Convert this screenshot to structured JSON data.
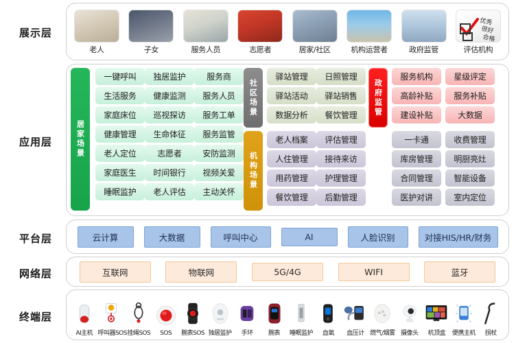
{
  "layers": [
    {
      "key": "presentation",
      "label": "展示层"
    },
    {
      "key": "application",
      "label": "应用层"
    },
    {
      "key": "platform",
      "label": "平台层"
    },
    {
      "key": "network",
      "label": "网络层"
    },
    {
      "key": "terminal",
      "label": "终端层"
    }
  ],
  "presentation": {
    "personas": [
      {
        "caption": "老人",
        "icon": "elderly-couple-photo"
      },
      {
        "caption": "子女",
        "icon": "family-children-photo"
      },
      {
        "caption": "服务人员",
        "icon": "caregiver-photo"
      },
      {
        "caption": "志愿者",
        "icon": "volunteers-photo"
      },
      {
        "caption": "居家/社区",
        "icon": "community-street-photo"
      },
      {
        "caption": "机构运营者",
        "icon": "institution-building-photo"
      },
      {
        "caption": "政府监管",
        "icon": "government-building-photo"
      },
      {
        "caption": "评估机构",
        "icon": "assessment-checklist-photo"
      }
    ]
  },
  "application": {
    "scenarios": [
      {
        "key": "home",
        "label": "居家场景",
        "color": "#19a84c"
      },
      {
        "key": "community",
        "label": "社区场景",
        "color": "#7b7b7b"
      },
      {
        "key": "institution",
        "label": "机构场景",
        "color": "#d59a0c"
      },
      {
        "key": "government",
        "label": "政府监管",
        "color": "#e60000"
      }
    ],
    "home_columns": [
      {
        "style": "c-mint",
        "items": [
          "一键呼叫",
          "生活服务",
          "家庭床位",
          "健康管理",
          "老人定位",
          "家庭医生",
          "睡眠监护"
        ]
      },
      {
        "style": "c-mint",
        "items": [
          "独居监护",
          "健康监测",
          "巡视探访",
          "生命体征",
          "志愿者",
          "时间银行",
          "老人评估"
        ]
      },
      {
        "style": "c-mint",
        "items": [
          "服务商",
          "服务人员",
          "服务工单",
          "服务监管",
          "安防监测",
          "视频关爱",
          "主动关怀"
        ]
      }
    ],
    "community_columns": [
      {
        "style": "c-olive",
        "items": [
          "驿站管理",
          "驿站活动",
          "数据分析"
        ]
      },
      {
        "style": "c-olive",
        "items": [
          "日照管理",
          "驿站销售",
          "餐饮管理"
        ]
      }
    ],
    "institution_columns": [
      {
        "style": "c-lilac",
        "items": [
          "老人档案",
          "人住管理",
          "用药管理",
          "餐饮管理"
        ]
      },
      {
        "style": "c-lilac",
        "items": [
          "评估管理",
          "接待来访",
          "护理管理",
          "后勤管理"
        ]
      }
    ],
    "government_columns": [
      {
        "style": "c-pink",
        "items": [
          "服务机构",
          "高龄补贴",
          "建设补贴"
        ]
      },
      {
        "style": "c-pink",
        "items": [
          "星级评定",
          "服务补贴",
          "大数据"
        ]
      }
    ],
    "operation_columns": [
      {
        "style": "c-gray",
        "items": [
          "一卡通",
          "库房管理",
          "合同管理",
          "医护对讲"
        ]
      },
      {
        "style": "c-gray",
        "items": [
          "收费管理",
          "明厨亮灶",
          "智能设备",
          "室内定位"
        ]
      }
    ]
  },
  "platform": {
    "items": [
      {
        "label": "云计算",
        "width": 82
      },
      {
        "label": "大数据",
        "width": 82
      },
      {
        "label": "呼叫中心",
        "width": 88
      },
      {
        "label": "AI",
        "width": 82
      },
      {
        "label": "人脸识别",
        "width": 88
      },
      {
        "label": "对接HIS/HR/财务",
        "width": 116
      }
    ]
  },
  "network": {
    "items": [
      {
        "label": "互联网"
      },
      {
        "label": "物联网"
      },
      {
        "label": "5G/4G"
      },
      {
        "label": "WIFI"
      },
      {
        "label": "蓝牙"
      }
    ]
  },
  "terminal": {
    "devices": [
      {
        "caption": "AI主机",
        "icon": "ai-host-device-icon"
      },
      {
        "caption": "呼叫器SOS",
        "icon": "pager-sos-icon"
      },
      {
        "caption": "挂绳SOS",
        "icon": "lanyard-sos-icon"
      },
      {
        "caption": "SOS",
        "icon": "sos-button-icon"
      },
      {
        "caption": "腕表SOS",
        "icon": "watch-sos-icon"
      },
      {
        "caption": "独居监护",
        "icon": "solitary-monitor-icon"
      },
      {
        "caption": "手环",
        "icon": "wristband-icon"
      },
      {
        "caption": "腕表",
        "icon": "smartwatch-icon"
      },
      {
        "caption": "睡眠监护",
        "icon": "sleep-monitor-icon"
      },
      {
        "caption": "血氧",
        "icon": "oximeter-icon"
      },
      {
        "caption": "血压计",
        "icon": "blood-pressure-monitor-icon"
      },
      {
        "caption": "燃气/烟雾",
        "icon": "gas-smoke-detector-icon"
      },
      {
        "caption": "摄像头",
        "icon": "camera-icon"
      },
      {
        "caption": "机顶盒",
        "icon": "set-top-box-tv-icon"
      },
      {
        "caption": "便携主机",
        "icon": "portable-host-icon"
      },
      {
        "caption": "拐杖",
        "icon": "walking-cane-icon"
      }
    ]
  },
  "colors": {
    "home": "#19a84c",
    "community": "#7b7b7b",
    "institution": "#d59a0c",
    "government": "#e60000",
    "platform_chip": "#a8c4e8",
    "network_chip": "#fdeada"
  }
}
